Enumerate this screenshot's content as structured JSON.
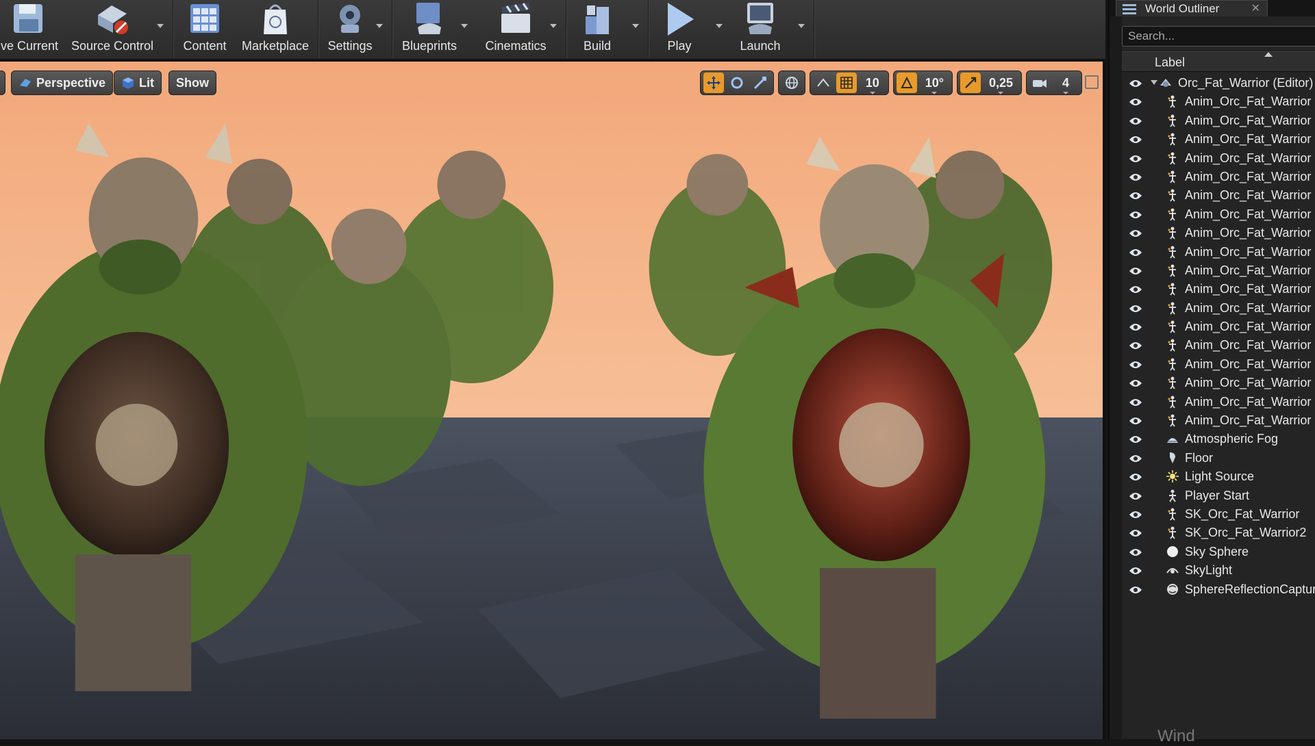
{
  "toolbar": {
    "buttons": [
      {
        "label": "ve Current",
        "icon": "save-icon"
      },
      {
        "label": "Source Control",
        "icon": "source-control-icon"
      },
      {
        "label": "Content",
        "icon": "content-icon"
      },
      {
        "label": "Marketplace",
        "icon": "marketplace-icon"
      },
      {
        "label": "Settings",
        "icon": "settings-icon"
      },
      {
        "label": "Blueprints",
        "icon": "blueprints-icon"
      },
      {
        "label": "Cinematics",
        "icon": "cinematics-icon"
      },
      {
        "label": "Build",
        "icon": "build-icon"
      },
      {
        "label": "Play",
        "icon": "play-icon"
      },
      {
        "label": "Launch",
        "icon": "launch-icon"
      }
    ]
  },
  "viewport": {
    "perspective_label": "Perspective",
    "lit_label": "Lit",
    "show_label": "Show",
    "grid_snap_value": "10",
    "rotation_snap_value": "10°",
    "scale_snap_value": "0,25",
    "camera_speed_value": "4",
    "colors": {
      "accent": "#e89a2a",
      "sky_top": "#f7b07e",
      "sky_bottom": "#fbd2ae",
      "floor": "#3a3f4a"
    }
  },
  "outliner": {
    "tab_title": "World Outliner",
    "search_placeholder": "Search...",
    "column_label": "Label",
    "footer_text": "Wind",
    "rows": [
      {
        "label": "Orc_Fat_Warrior (Editor)",
        "icon": "world-icon",
        "indent": 0
      },
      {
        "label": "Anim_Orc_Fat_Warrior",
        "icon": "skeletal-mesh-icon",
        "indent": 1
      },
      {
        "label": "Anim_Orc_Fat_Warrior",
        "icon": "skeletal-mesh-icon",
        "indent": 1
      },
      {
        "label": "Anim_Orc_Fat_Warrior",
        "icon": "skeletal-mesh-icon",
        "indent": 1
      },
      {
        "label": "Anim_Orc_Fat_Warrior",
        "icon": "skeletal-mesh-icon",
        "indent": 1
      },
      {
        "label": "Anim_Orc_Fat_Warrior",
        "icon": "skeletal-mesh-icon",
        "indent": 1
      },
      {
        "label": "Anim_Orc_Fat_Warrior",
        "icon": "skeletal-mesh-icon",
        "indent": 1
      },
      {
        "label": "Anim_Orc_Fat_Warrior",
        "icon": "skeletal-mesh-icon",
        "indent": 1
      },
      {
        "label": "Anim_Orc_Fat_Warrior",
        "icon": "skeletal-mesh-icon",
        "indent": 1
      },
      {
        "label": "Anim_Orc_Fat_Warrior",
        "icon": "skeletal-mesh-icon",
        "indent": 1
      },
      {
        "label": "Anim_Orc_Fat_Warrior",
        "icon": "skeletal-mesh-icon",
        "indent": 1
      },
      {
        "label": "Anim_Orc_Fat_Warrior",
        "icon": "skeletal-mesh-icon",
        "indent": 1
      },
      {
        "label": "Anim_Orc_Fat_Warrior",
        "icon": "skeletal-mesh-icon",
        "indent": 1
      },
      {
        "label": "Anim_Orc_Fat_Warrior",
        "icon": "skeletal-mesh-icon",
        "indent": 1
      },
      {
        "label": "Anim_Orc_Fat_Warrior",
        "icon": "skeletal-mesh-icon",
        "indent": 1
      },
      {
        "label": "Anim_Orc_Fat_Warrior",
        "icon": "skeletal-mesh-icon",
        "indent": 1
      },
      {
        "label": "Anim_Orc_Fat_Warrior",
        "icon": "skeletal-mesh-icon",
        "indent": 1
      },
      {
        "label": "Anim_Orc_Fat_Warrior",
        "icon": "skeletal-mesh-icon",
        "indent": 1
      },
      {
        "label": "Anim_Orc_Fat_Warrior",
        "icon": "skeletal-mesh-icon",
        "indent": 1
      },
      {
        "label": "Atmospheric Fog",
        "icon": "fog-icon",
        "indent": 1
      },
      {
        "label": "Floor",
        "icon": "static-mesh-icon",
        "indent": 1
      },
      {
        "label": "Light Source",
        "icon": "light-icon",
        "indent": 1
      },
      {
        "label": "Player Start",
        "icon": "player-start-icon",
        "indent": 1
      },
      {
        "label": "SK_Orc_Fat_Warrior",
        "icon": "skeletal-mesh-icon",
        "indent": 1
      },
      {
        "label": "SK_Orc_Fat_Warrior2",
        "icon": "skeletal-mesh-icon",
        "indent": 1
      },
      {
        "label": "Sky Sphere",
        "icon": "sphere-icon",
        "indent": 1
      },
      {
        "label": "SkyLight",
        "icon": "skylight-icon",
        "indent": 1
      },
      {
        "label": "SphereReflectionCapture",
        "icon": "reflection-capture-icon",
        "indent": 1
      }
    ]
  }
}
